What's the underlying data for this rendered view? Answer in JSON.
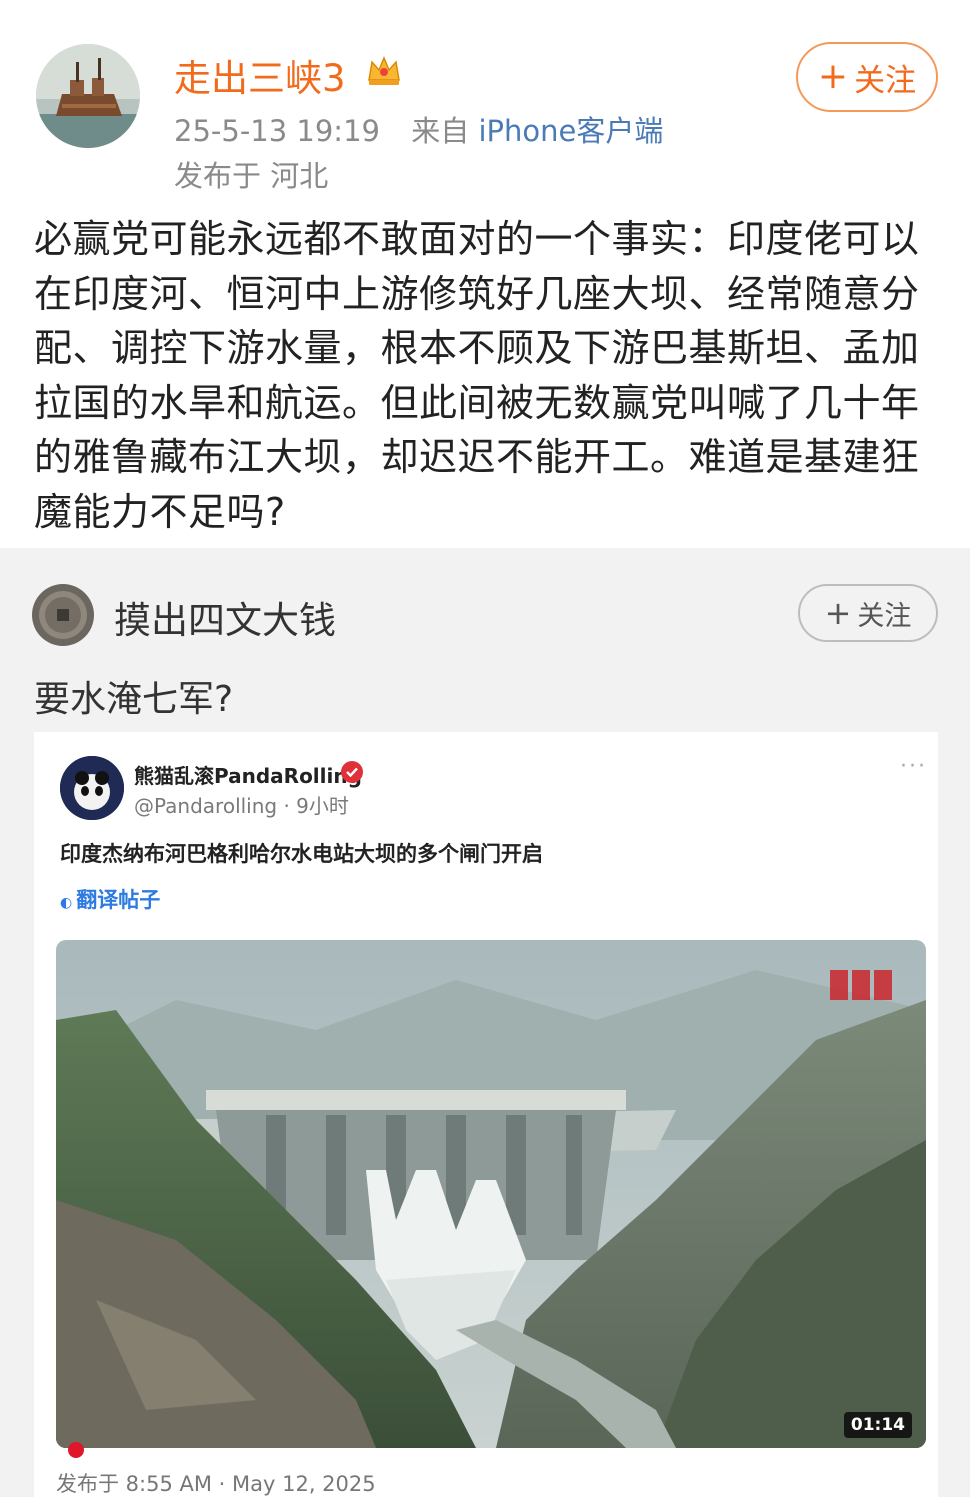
{
  "post": {
    "author_name": "走出三峡3",
    "follow_label": "关注",
    "time": "25-5-13 19:19",
    "source_prefix": "来自",
    "source_name": "iPhone客户端",
    "location": "发布于 河北",
    "body": "必赢党可能永远都不敢面对的一个事实：印度佬可以在印度河、恒河中上游修筑好几座大坝、经常随意分配、调控下游水量，根本不顾及下游巴基斯坦、孟加拉国的水旱和航运。但此间被无数赢党叫喊了几十年的雅鲁藏布江大坝，却迟迟不能开工。难道是基建狂魔能力不足吗?"
  },
  "repost": {
    "author_name": "摸出四文大钱",
    "follow_label": "关注",
    "text": "要水淹七军?",
    "tweet": {
      "display_name": "熊猫乱滚PandaRolling",
      "handle_time": "@Pandarolling · 9小时",
      "text": "印度杰纳布河巴格利哈尔水电站大坝的多个闸门开启",
      "translate_label": "翻译帖子",
      "video_duration": "01:14",
      "footer": "发布于 8:55 AM · May 12, 2025"
    }
  },
  "colors": {
    "accent": "#f26a1b",
    "link": "#4a7bb7",
    "card_bg": "#f2f2f2"
  },
  "icons": [
    "plus-icon",
    "crown-icon",
    "verified-icon",
    "more-icon",
    "globe-icon"
  ]
}
